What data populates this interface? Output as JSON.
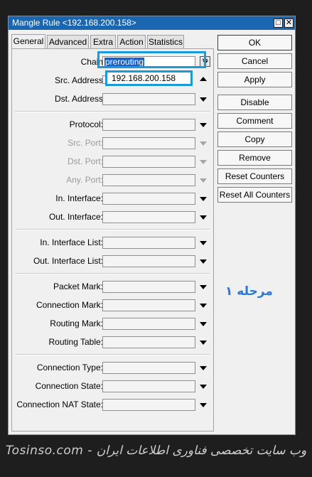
{
  "window": {
    "title": "Mangle Rule <192.168.200.158>"
  },
  "tabs": [
    "General",
    "Advanced",
    "Extra",
    "Action",
    "Statistics"
  ],
  "form": {
    "chain_label": "Chain",
    "chain_value": "prerouting",
    "src_address_label": "Src. Address",
    "src_address_suggestion": "192.168.200.158",
    "dst_address_label": "Dst. Address",
    "protocol_label": "Protocol:",
    "src_port_label": "Src. Port:",
    "dst_port_label": "Dst. Port:",
    "any_port_label": "Any. Port:",
    "in_interface_label": "In. Interface:",
    "out_interface_label": "Out. Interface:",
    "in_interface_list_label": "In. Interface List:",
    "out_interface_list_label": "Out. Interface List:",
    "packet_mark_label": "Packet Mark:",
    "connection_mark_label": "Connection Mark:",
    "routing_mark_label": "Routing Mark:",
    "routing_table_label": "Routing Table:",
    "connection_type_label": "Connection Type:",
    "connection_state_label": "Connection State:",
    "connection_nat_state_label": "Connection NAT State:"
  },
  "buttons": {
    "ok": "OK",
    "cancel": "Cancel",
    "apply": "Apply",
    "disable": "Disable",
    "comment": "Comment",
    "copy": "Copy",
    "remove": "Remove",
    "reset_counters": "Reset Counters",
    "reset_all_counters": "Reset All Counters"
  },
  "annotation": {
    "step": "مرحله ۱"
  },
  "watermark": "Tosinso.com - وب سایت تخصصی فناوری اطلاعات ایران",
  "colors": {
    "titlebar": "#1b66b0",
    "highlight": "#1a9ad6",
    "annotation": "#2a77d4",
    "selection": "#1761c7"
  }
}
